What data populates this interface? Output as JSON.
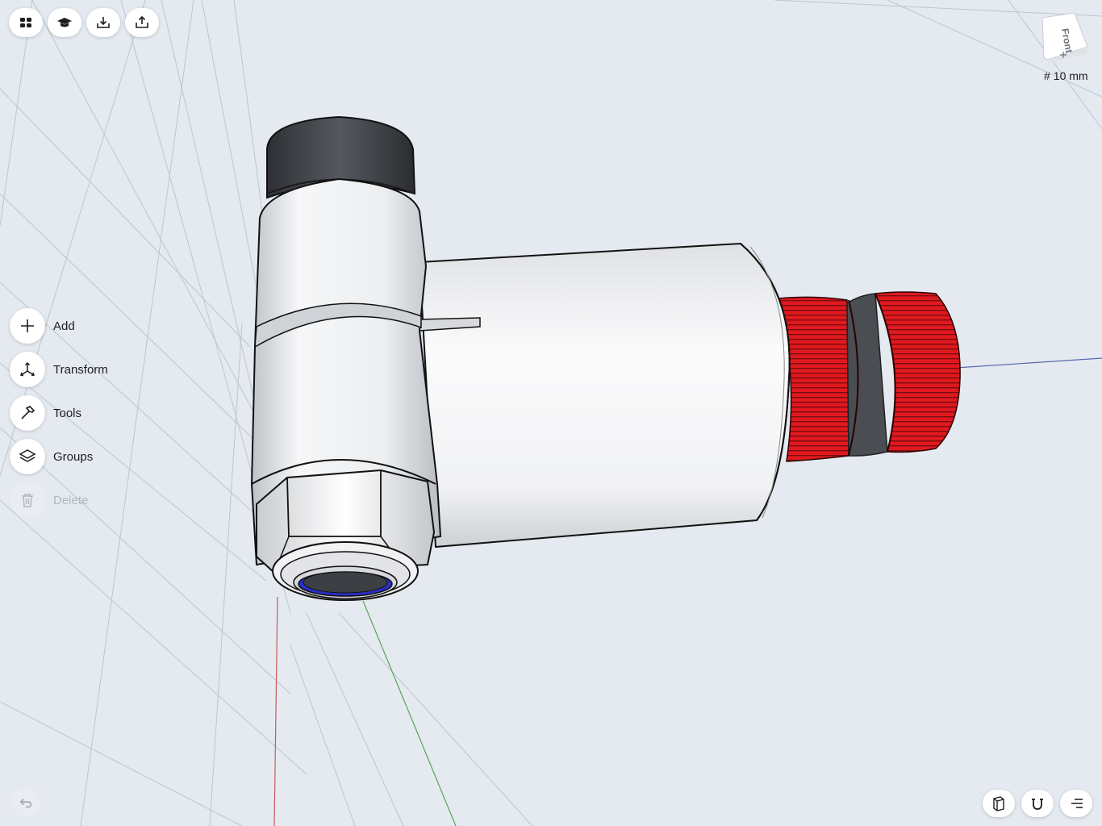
{
  "toolbar": {
    "items": [
      {
        "name": "library-button",
        "icon": "grid-four-icon"
      },
      {
        "name": "learn-button",
        "icon": "graduation-cap-icon"
      },
      {
        "name": "import-button",
        "icon": "import-tray-icon"
      },
      {
        "name": "export-button",
        "icon": "share-icon"
      }
    ]
  },
  "sidebar": {
    "items": [
      {
        "label": "Add",
        "icon": "plus-icon",
        "enabled": true
      },
      {
        "label": "Transform",
        "icon": "transform-axes-icon",
        "enabled": true
      },
      {
        "label": "Tools",
        "icon": "hammer-icon",
        "enabled": true
      },
      {
        "label": "Groups",
        "icon": "layers-icon",
        "enabled": true
      },
      {
        "label": "Delete",
        "icon": "trash-icon",
        "enabled": false
      }
    ]
  },
  "view_cube": {
    "face_label": "Front"
  },
  "grid": {
    "symbol": "#",
    "size_label": "10 mm"
  },
  "bottom_bar": {
    "left": {
      "icon": "undo-arrow-icon"
    },
    "right": [
      {
        "name": "view-mode-button",
        "icon": "box-wireframe-icon"
      },
      {
        "name": "snapping-button",
        "icon": "magnet-icon"
      },
      {
        "name": "menu-button",
        "icon": "list-lines-icon"
      }
    ]
  },
  "colors": {
    "background": "#e4eaf0",
    "grid_line": "#bcc6cf",
    "x_axis": "#c85a5a",
    "y_axis": "#5aa35a",
    "z_axis": "#5a67b0",
    "model_red": "#e0191f",
    "model_dark": "#3f4247",
    "model_body": "#f0f1f3",
    "ring_blue": "#2a2fc8"
  }
}
